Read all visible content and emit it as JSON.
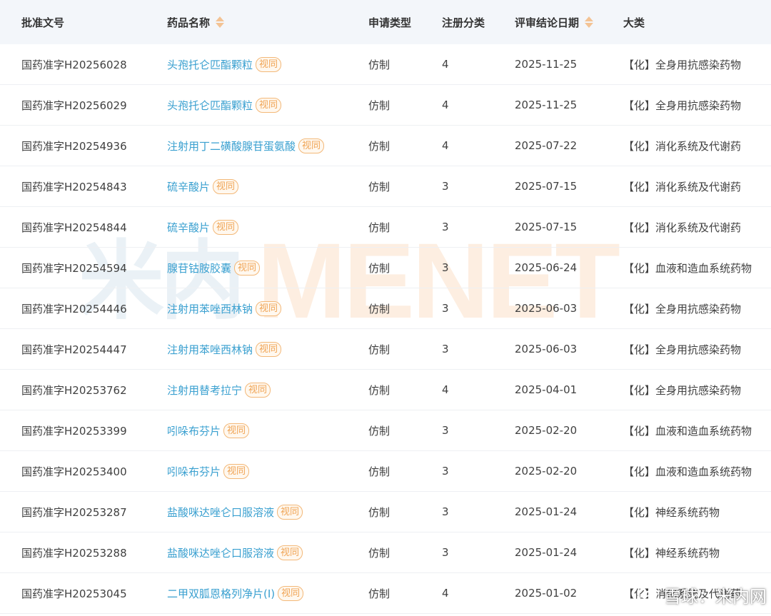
{
  "table": {
    "headers": [
      {
        "label": "批准文号",
        "sortable": false
      },
      {
        "label": "药品名称",
        "sortable": true
      },
      {
        "label": "申请类型",
        "sortable": false
      },
      {
        "label": "注册分类",
        "sortable": false
      },
      {
        "label": "评审结论日期",
        "sortable": true
      },
      {
        "label": "大类",
        "sortable": false
      }
    ],
    "rows": [
      {
        "approval_no": "国药准字H20256028",
        "drug_name": "头孢托仑匹酯颗粒",
        "tag": "视同",
        "app_type": "仿制",
        "reg_class": "4",
        "date": "2025-11-25",
        "category": "【化】全身用抗感染药物"
      },
      {
        "approval_no": "国药准字H20256029",
        "drug_name": "头孢托仑匹酯颗粒",
        "tag": "视同",
        "app_type": "仿制",
        "reg_class": "4",
        "date": "2025-11-25",
        "category": "【化】全身用抗感染药物"
      },
      {
        "approval_no": "国药准字H20254936",
        "drug_name": "注射用丁二磺酸腺苷蛋氨酸",
        "tag": "视同",
        "app_type": "仿制",
        "reg_class": "4",
        "date": "2025-07-22",
        "category": "【化】消化系统及代谢药"
      },
      {
        "approval_no": "国药准字H20254843",
        "drug_name": "硫辛酸片",
        "tag": "视同",
        "app_type": "仿制",
        "reg_class": "3",
        "date": "2025-07-15",
        "category": "【化】消化系统及代谢药"
      },
      {
        "approval_no": "国药准字H20254844",
        "drug_name": "硫辛酸片",
        "tag": "视同",
        "app_type": "仿制",
        "reg_class": "3",
        "date": "2025-07-15",
        "category": "【化】消化系统及代谢药"
      },
      {
        "approval_no": "国药准字H20254594",
        "drug_name": "腺苷钴胺胶囊",
        "tag": "视同",
        "app_type": "仿制",
        "reg_class": "3",
        "date": "2025-06-24",
        "category": "【化】血液和造血系统药物"
      },
      {
        "approval_no": "国药准字H20254446",
        "drug_name": "注射用苯唑西林钠",
        "tag": "视同",
        "app_type": "仿制",
        "reg_class": "3",
        "date": "2025-06-03",
        "category": "【化】全身用抗感染药物"
      },
      {
        "approval_no": "国药准字H20254447",
        "drug_name": "注射用苯唑西林钠",
        "tag": "视同",
        "app_type": "仿制",
        "reg_class": "3",
        "date": "2025-06-03",
        "category": "【化】全身用抗感染药物"
      },
      {
        "approval_no": "国药准字H20253762",
        "drug_name": "注射用替考拉宁",
        "tag": "视同",
        "app_type": "仿制",
        "reg_class": "4",
        "date": "2025-04-01",
        "category": "【化】全身用抗感染药物"
      },
      {
        "approval_no": "国药准字H20253399",
        "drug_name": "吲哚布芬片",
        "tag": "视同",
        "app_type": "仿制",
        "reg_class": "3",
        "date": "2025-02-20",
        "category": "【化】血液和造血系统药物"
      },
      {
        "approval_no": "国药准字H20253400",
        "drug_name": "吲哚布芬片",
        "tag": "视同",
        "app_type": "仿制",
        "reg_class": "3",
        "date": "2025-02-20",
        "category": "【化】血液和造血系统药物"
      },
      {
        "approval_no": "国药准字H20253287",
        "drug_name": "盐酸咪达唑仑口服溶液",
        "tag": "视同",
        "app_type": "仿制",
        "reg_class": "3",
        "date": "2025-01-24",
        "category": "【化】神经系统药物"
      },
      {
        "approval_no": "国药准字H20253288",
        "drug_name": "盐酸咪达唑仑口服溶液",
        "tag": "视同",
        "app_type": "仿制",
        "reg_class": "3",
        "date": "2025-01-24",
        "category": "【化】神经系统药物"
      },
      {
        "approval_no": "国药准字H20253045",
        "drug_name": "二甲双胍恩格列净片(Ⅰ)",
        "tag": "视同",
        "app_type": "仿制",
        "reg_class": "4",
        "date": "2025-01-02",
        "category": "【化】消化系统及代谢药"
      }
    ]
  },
  "watermark": {
    "brand_cn": "米内",
    "brand_en": "MENET",
    "corner_text": "雪球：米内网",
    "corner_icon": "snowball-logo-icon"
  },
  "colors": {
    "link": "#3aa0d0",
    "tag": "#f0a455",
    "header_bg": "#f3f6fa",
    "sort_arrow": "#f3c394"
  }
}
